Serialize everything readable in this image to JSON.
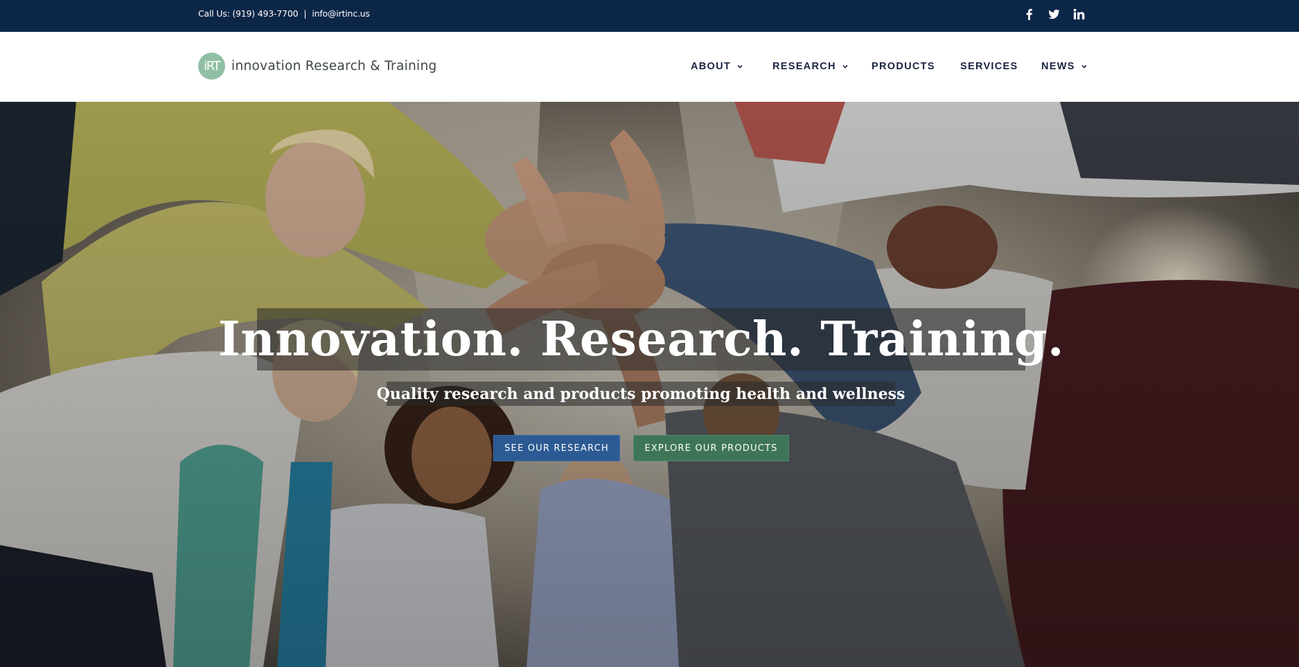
{
  "topbar": {
    "phone_text": "Call Us: (919) 493-7700",
    "separator": "|",
    "email": "info@irtinc.us",
    "social_icons": [
      "facebook-icon",
      "twitter-icon",
      "linkedin-icon"
    ]
  },
  "header": {
    "logo": {
      "badge": "iRT",
      "name": "innovation Research & Training"
    },
    "nav": [
      {
        "label": "ABOUT",
        "has_dropdown": true
      },
      {
        "label": "RESEARCH",
        "has_dropdown": true
      },
      {
        "label": "PRODUCTS",
        "has_dropdown": false
      },
      {
        "label": "SERVICES",
        "has_dropdown": false
      },
      {
        "label": "NEWS",
        "has_dropdown": true
      }
    ]
  },
  "hero": {
    "title": "Innovation. Research. Training.",
    "subtitle": "Quality research and products promoting health and wellness",
    "buttons": {
      "research": "SEE OUR RESEARCH",
      "products": "EXPLORE OUR PRODUCTS"
    }
  },
  "colors": {
    "topbar_bg": "#0c2647",
    "nav_text": "#1a2540",
    "logo_badge": "#90bfa6",
    "btn_research": "#2c5a93",
    "btn_products": "#3e7559"
  }
}
